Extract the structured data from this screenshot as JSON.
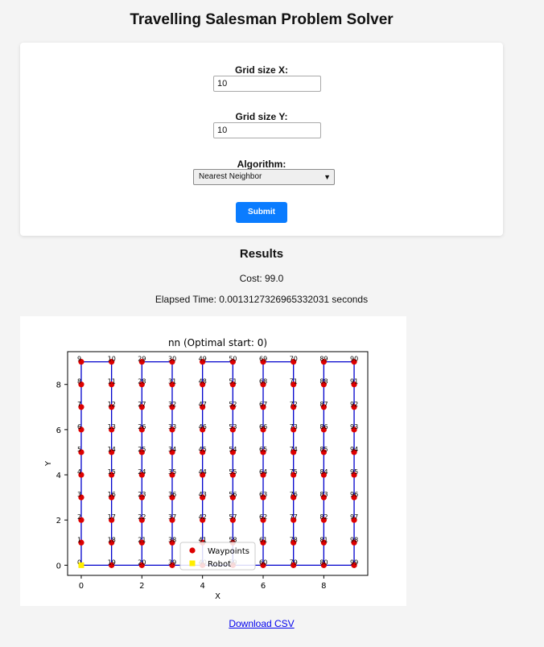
{
  "page": {
    "title": "Travelling Salesman Problem Solver"
  },
  "form": {
    "grid_x_label": "Grid size X:",
    "grid_x_value": "10",
    "grid_y_label": "Grid size Y:",
    "grid_y_value": "10",
    "algorithm_label": "Algorithm:",
    "algorithm_selected": "Nearest Neighbor",
    "submit_label": "Submit"
  },
  "results": {
    "title": "Results",
    "cost": "Cost: 99.0",
    "elapsed": "Elapsed Time: 0.0013127326965332031 seconds",
    "download_label": "Download CSV"
  },
  "colors": {
    "accent": "#0a7cff",
    "route": "#0000cc",
    "waypoint": "#dd0000",
    "robot": "#ffee00"
  },
  "chart_data": {
    "type": "scatter",
    "title": "nn (Optimal start: 0)",
    "xlabel": "X",
    "ylabel": "Y",
    "xlim": [
      -0.45,
      9.45
    ],
    "ylim": [
      -0.45,
      9.45
    ],
    "xticks": [
      0,
      2,
      4,
      6,
      8
    ],
    "yticks": [
      0,
      2,
      4,
      6,
      8
    ],
    "legend": {
      "placement": "bottom-center",
      "entries": [
        "Waypoints",
        "Robot"
      ]
    },
    "robot": {
      "x": 0,
      "y": 0
    },
    "waypoints": {
      "description_rule": "index = 10*x + (y if x even else 9-y)",
      "grid_x": 10,
      "grid_y": 10
    },
    "route_order": "0..99 serpentine, return to 0"
  }
}
